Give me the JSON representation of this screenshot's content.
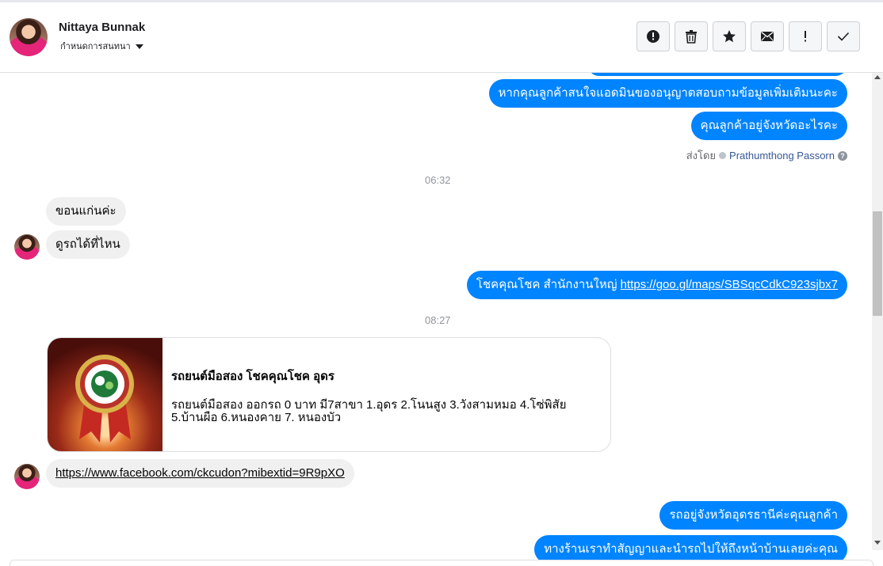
{
  "header": {
    "contact_name": "Nittaya Bunnak",
    "conversation_settings": "กำหนดการสนทนา",
    "toolbar": [
      {
        "name": "report-button",
        "icon": "exclamation-circle-icon"
      },
      {
        "name": "delete-button",
        "icon": "trash-icon"
      },
      {
        "name": "star-button",
        "icon": "star-icon"
      },
      {
        "name": "mark-unread-button",
        "icon": "envelope-icon"
      },
      {
        "name": "follow-up-button",
        "icon": "exclamation-icon"
      },
      {
        "name": "mark-done-button",
        "icon": "check-icon"
      }
    ]
  },
  "messages": {
    "out_1": "หากคุณลูกค้าสนใจแอดมินของอนุญาตสอบถามข้อมูลเพิ่มเติมนะคะ",
    "out_2": "คุณลูกค้าอยู่จังหวัดอะไรคะ",
    "sent_by_prefix": "ส่งโดย",
    "sent_by_name": "Prathumthong Passorn",
    "time_1": "06:32",
    "in_1": "ขอนแก่นค่ะ",
    "in_2": "ดูรถได้ที่ไหน",
    "out_3_text": "โชคคุณโชค สำนักงานใหญ่ ",
    "out_3_link": "https://goo.gl/maps/SBSqcCdkC923sjbx7",
    "time_2": "08:27",
    "card_title": "รถยนต์มือสอง โชคคุณโชค อุดร",
    "card_desc": "รถยนต์มือสอง ออกรถ 0 บาท มี7สาขา 1.อุดร 2.โนนสูง 3.วังสามหมอ 4.โซ่พิสัย 5.บ้านผือ 6.หนองคาย 7. หนองบัว",
    "in_3_link": "https://www.facebook.com/ckcudon?mibextid=9R9pXO",
    "out_4": "รถอยู่จังหวัดอุดรธานีค่ะคุณลูกค้า",
    "out_5": "ทางร้านเราทำสัญญาและนำรถไปให้ถึงหน้าบ้านเลยค่ะคุณ"
  },
  "colors": {
    "outgoing_bubble": "#0084ff",
    "incoming_bubble": "#f0f0f0",
    "link_blue": "#385898"
  }
}
